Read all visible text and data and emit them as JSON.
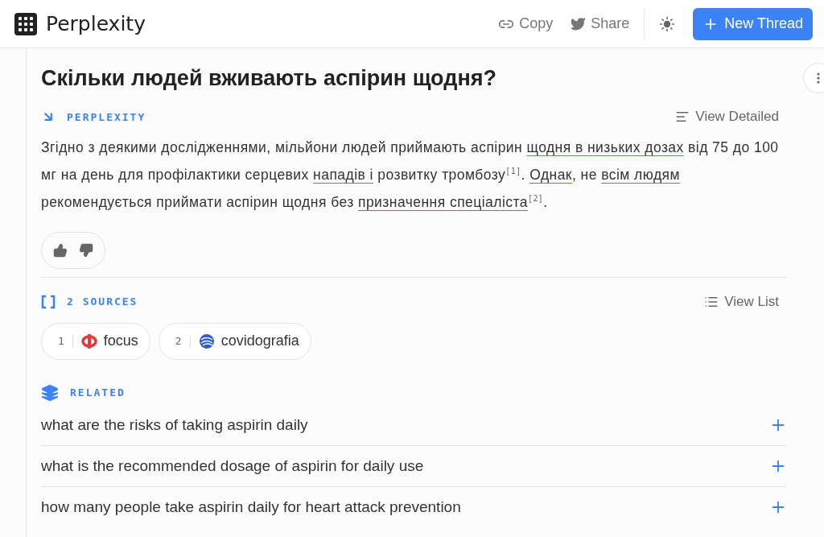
{
  "header": {
    "brand": "Perplexity",
    "actions": [
      {
        "kind": "copy",
        "label": "Copy"
      },
      {
        "kind": "share",
        "label": "Share"
      }
    ],
    "new_thread": "New Thread"
  },
  "question": "Скільки людей вживають аспірин щодня?",
  "answer": {
    "label": "PERPLEXITY",
    "view": "View Detailed",
    "segments": [
      {
        "kind": "text",
        "text": "Згідно з деякими дослідженнями, мільйони людей приймають аспірин "
      },
      {
        "kind": "link",
        "text": "щодня в низьких дозах"
      },
      {
        "kind": "text",
        "text": " від 75 до 100 мг на день для профілактики серцевих "
      },
      {
        "kind": "link",
        "text": "нападів і"
      },
      {
        "kind": "text",
        "text": " розвитку тромбозу"
      },
      {
        "kind": "cite",
        "text": "[1]"
      },
      {
        "kind": "text",
        "text": ". "
      },
      {
        "kind": "link",
        "text": "Однак"
      },
      {
        "kind": "text",
        "text": ", не "
      },
      {
        "kind": "link",
        "text": "всім людям"
      },
      {
        "kind": "text",
        "text": " рекомендується приймати аспірин щодня без "
      },
      {
        "kind": "link",
        "text": "призначення спеціаліста"
      },
      {
        "kind": "cite",
        "text": "[2]"
      },
      {
        "kind": "text",
        "text": "."
      }
    ]
  },
  "sources": {
    "label": "2 SOURCES",
    "view": "View List",
    "items": [
      {
        "index": "1",
        "name": "focus",
        "kind": "focus"
      },
      {
        "index": "2",
        "name": "covidografia",
        "kind": "globe"
      }
    ]
  },
  "related": {
    "label": "RELATED",
    "items": [
      "what are the risks of taking aspirin daily",
      "what is the recommended dosage of aspirin for daily use",
      "how many people take aspirin daily for heart attack prevention"
    ]
  }
}
